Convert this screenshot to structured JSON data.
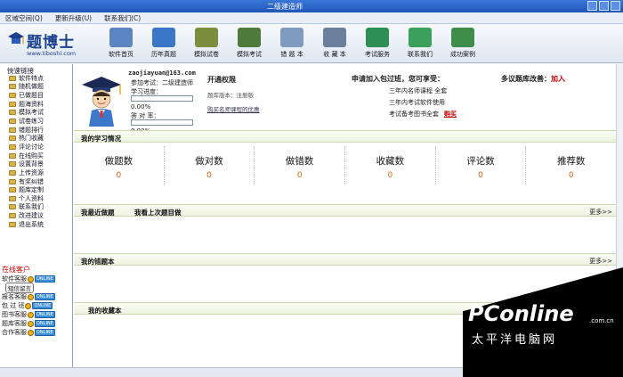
{
  "window": {
    "title": "二级建造师"
  },
  "menu": [
    "区域空间(Q)",
    "更新升级(U)",
    "联系我们(C)"
  ],
  "logo": {
    "brand": "题博士",
    "url": "www.tiboshi.com"
  },
  "toolbar": [
    {
      "label": "软件首页",
      "icon": "home-icon",
      "color": "#5b86c2"
    },
    {
      "label": "历年真题",
      "icon": "book-icon",
      "color": "#3a77c9"
    },
    {
      "label": "模拟试卷",
      "icon": "exam-icon",
      "color": "#7a8f3d"
    },
    {
      "label": "模拟考试",
      "icon": "test-icon",
      "color": "#4e7a3a"
    },
    {
      "label": "错 题 本",
      "icon": "notebook-icon",
      "color": "#7f9bc0"
    },
    {
      "label": "收 藏 本",
      "icon": "bookmark-icon",
      "color": "#6b7f9c"
    },
    {
      "label": "考试服务",
      "icon": "service-icon",
      "color": "#2e8f55"
    },
    {
      "label": "联系我们",
      "icon": "contact-icon",
      "color": "#3aa15a"
    },
    {
      "label": "成功案例",
      "icon": "case-icon",
      "color": "#3e8d4a"
    }
  ],
  "sidebar": {
    "title": "快速链接",
    "items": [
      "软件特点",
      "随机做题",
      "已做题目",
      "题海资料",
      "模拟考试",
      "试卷练习",
      "错题排行",
      "热门收藏",
      "评论讨论",
      "在线购买",
      "设置背景",
      "上传资源",
      "有奖纠错",
      "题库定制",
      "个人资料",
      "联系我们",
      "改进建议",
      "退出系统"
    ],
    "online": {
      "title": "在线客户",
      "badge": "ONLINE",
      "sms_label": "短信留言",
      "agents": [
        "软件客服",
        "报名客服",
        "包 过 班",
        "图书客服",
        "题库客服",
        "合作客服"
      ]
    }
  },
  "profile": {
    "email": "zaojiayuan@163.com",
    "exam": "参加考试：二级建造师",
    "progress_label": "学习进度：",
    "progress_value": "0.00%",
    "progress": 0,
    "accuracy_label": "答 对 率：",
    "accuracy_value": "0.00%",
    "accuracy": 0
  },
  "permission": {
    "title": "开通权限",
    "version": "题库版本：注册版",
    "link": "购买名师课程的优惠"
  },
  "apply": {
    "title": "申请加入包过班，您可享受：",
    "items": [
      "三年内名师课程 全套",
      "三年内考试软件使用",
      "考试备考图书全套"
    ],
    "buy": "购买"
  },
  "suggest": {
    "text": "多议题库改善：",
    "action": "加入"
  },
  "sections": {
    "study": {
      "title": "我的学习情况"
    },
    "recent": {
      "title": "我最近做题",
      "sub": "我看上次题目做",
      "more": "更多>>"
    },
    "wrong": {
      "title": "我的错题本",
      "more": "更多>>"
    },
    "favorites": {
      "title": "我的收藏本"
    }
  },
  "stats": [
    {
      "label": "做题数",
      "value": "0"
    },
    {
      "label": "做对数",
      "value": "0"
    },
    {
      "label": "做错数",
      "value": "0"
    },
    {
      "label": "收藏数",
      "value": "0"
    },
    {
      "label": "评论数",
      "value": "0"
    },
    {
      "label": "推荐数",
      "value": "0"
    }
  ],
  "watermark": {
    "brand": "PConline",
    "domain": ".com.cn",
    "cn": "太平洋电脑网"
  }
}
